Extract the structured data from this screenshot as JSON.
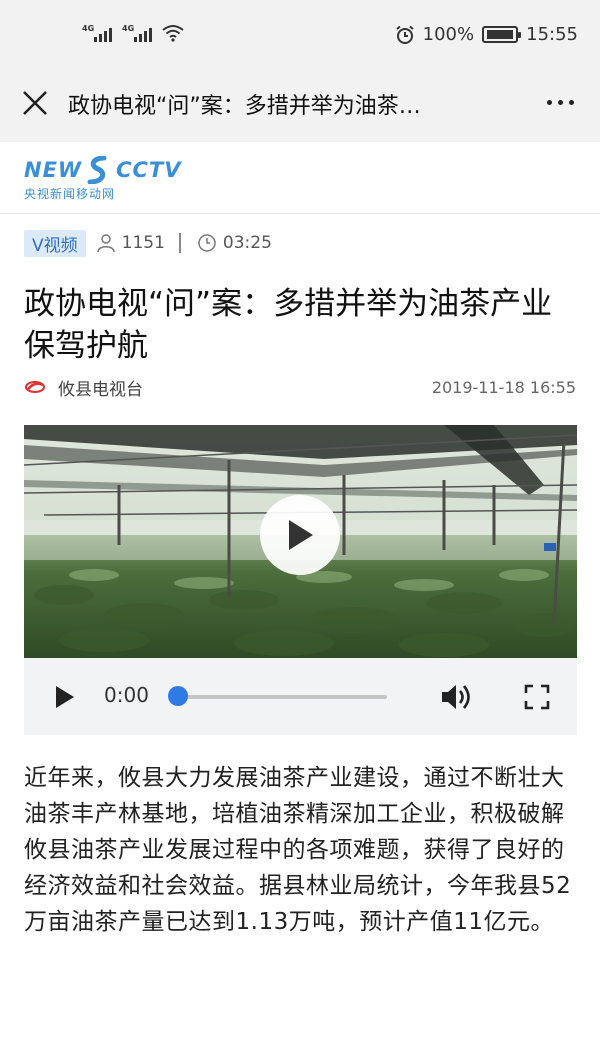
{
  "status_bar": {
    "signal1_label": "4G",
    "signal2_label": "4G",
    "battery": "100%",
    "time": "15:55",
    "icons": [
      "alarm-icon",
      "battery-charging-icon",
      "wifi-icon"
    ]
  },
  "titlebar": {
    "title": "政协电视“问”案：多措并举为油茶…"
  },
  "brand": {
    "logo_left": "NEW",
    "logo_right": "CCTV",
    "logo_sub": "央视新闻移动网",
    "color": "#3a8fd6"
  },
  "meta": {
    "tag": "V视频",
    "views": "1151",
    "duration": "03:25"
  },
  "article": {
    "headline": "政协电视“问”案：多措并举为油茶产业保驾护航",
    "source": "攸县电视台",
    "date": "2019-11-18 16:55",
    "body": "近年来，攸县大力发展油茶产业建设，通过不断壮大油茶丰产林基地，培植油茶精深加工企业，积极破解攸县油茶产业发展过程中的各项难题，获得了良好的经济效益和社会效益。据县林业局统计，今年我县52万亩油茶产量已达到1.13万吨，预计产值11亿元。"
  },
  "player": {
    "current_time": "0:00",
    "progress": 0,
    "accent": "#2f7ae5"
  }
}
